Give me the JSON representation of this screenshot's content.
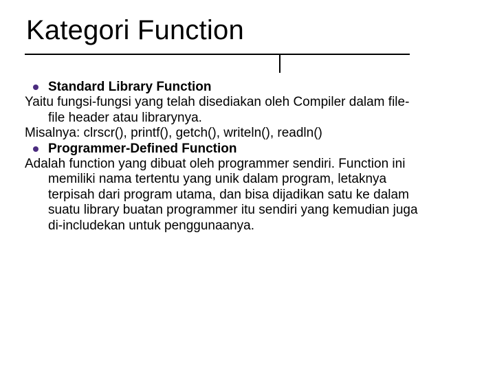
{
  "title": "Kategori Function",
  "bullet_color": "#4b2c7f",
  "items": [
    {
      "label": "Standard Library Function",
      "lines": [
        "Yaitu fungsi-fungsi yang telah disediakan oleh Compiler dalam file-",
        "file header atau librarynya.",
        "Misalnya: clrscr(), printf(), getch(), writeln(), readln()"
      ]
    },
    {
      "label": "Programmer-Defined Function",
      "lines": [
        "Adalah function yang dibuat oleh programmer sendiri. Function ini",
        "memiliki nama tertentu yang unik dalam program, letaknya",
        "terpisah dari program utama, dan bisa dijadikan satu ke dalam",
        "suatu library buatan programmer itu sendiri yang kemudian juga",
        "di-includekan untuk penggunaanya."
      ]
    }
  ]
}
